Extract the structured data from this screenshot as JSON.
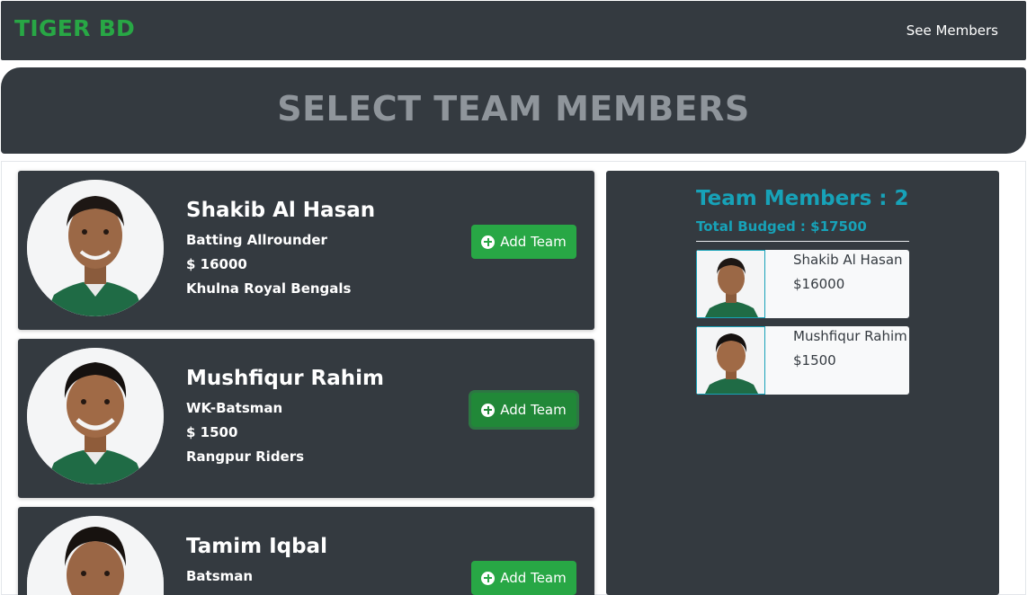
{
  "nav": {
    "brand": "TIGER BD",
    "see_members": "See Members"
  },
  "hero": {
    "title": "SELECT TEAM MEMBERS"
  },
  "players": [
    {
      "name": "Shakib Al Hasan",
      "role": "Batting Allrounder",
      "salary": "$ 16000",
      "team": "Khulna Royal Bengals",
      "button": "Add Team"
    },
    {
      "name": "Mushfiqur Rahim",
      "role": "WK-Batsman",
      "salary": "$ 1500",
      "team": "Rangpur Riders",
      "button": "Add Team"
    },
    {
      "name": "Tamim Iqbal",
      "role": "Batsman",
      "salary": "",
      "team": "",
      "button": "Add Team"
    }
  ],
  "team": {
    "title": "Team Members : 2",
    "budget": "Total Budged : $17500",
    "members": [
      {
        "name": "Shakib Al Hasan",
        "price": "$16000"
      },
      {
        "name": "Mushfiqur Rahim",
        "price": "$1500"
      }
    ]
  },
  "colors": {
    "dark": "#343a40",
    "accent_green": "#28a745",
    "accent_teal": "#17a2b8",
    "hero_text": "#8f959b"
  },
  "icons": {
    "add": "plus-circle-icon"
  }
}
